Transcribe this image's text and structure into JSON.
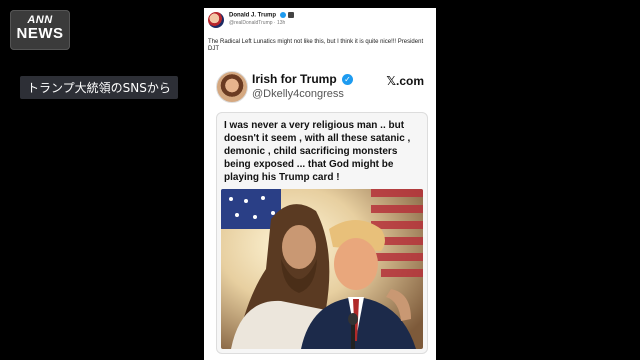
{
  "broadcaster": {
    "logo_top": "ANN",
    "logo_bottom": "NEWS"
  },
  "caption": "トランプ大統領のSNSから",
  "post": {
    "author_name": "Donald J. Trump",
    "author_handle": "@realDonaldTrump · 13h",
    "text": "The Radical Left Lunatics might not like this, but I think it is quite nice!!! President DJT"
  },
  "embedded_post": {
    "name": "Irish for Trump",
    "handle": "@Dkelly4congress",
    "brand": "𝕏.com",
    "quote": "I was never a very religious man .. but doesn't it seem , with all these satanic , demonic , child sacrificing monsters being exposed ... that God might be playing his Trump card !"
  },
  "icons": [
    "verified-badge-icon",
    "government-badge-icon",
    "x-logo-icon"
  ],
  "colors": {
    "background": "#000000",
    "verified": "#1d9bf0",
    "caption_bg": "#2d2f36"
  }
}
